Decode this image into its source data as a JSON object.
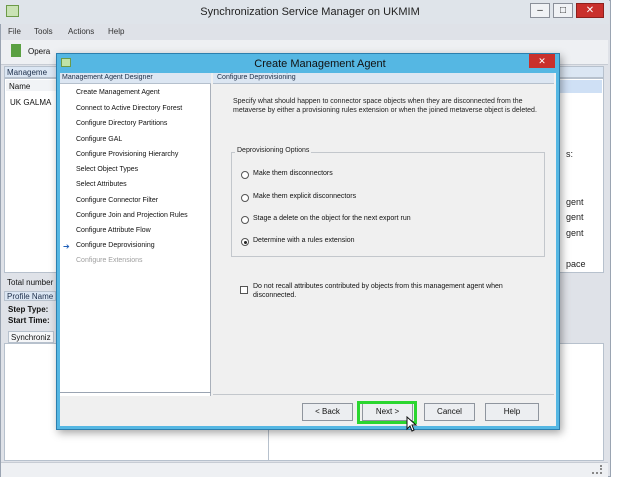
{
  "main_window": {
    "title": "Synchronization Service Manager on UKMIM",
    "controls": {
      "minimize": "–",
      "maximize": "□",
      "close": "✕"
    },
    "menu": [
      "File",
      "Tools",
      "Actions",
      "Help"
    ],
    "toolbar": {
      "operations_label": "Opera"
    },
    "management_agents_header": "Manageme",
    "columns": {
      "name": "Name"
    },
    "rows": [
      "UK GALMA"
    ],
    "right_fragments": [
      "gent",
      "gent",
      "gent",
      "pace",
      "s:"
    ],
    "total_label": "Total number",
    "profile_header": "Profile Name",
    "step_type_label": "Step Type:",
    "start_time_label": "Start Time:",
    "sync_tab_label": "Synchroniz"
  },
  "dialog": {
    "title": "Create Management Agent",
    "close": "✕",
    "nav": {
      "header": "Management Agent Designer",
      "items": [
        {
          "label": "Create Management Agent",
          "state": "done"
        },
        {
          "label": "Connect to Active Directory Forest",
          "state": "done"
        },
        {
          "label": "Configure Directory Partitions",
          "state": "done"
        },
        {
          "label": "Configure GAL",
          "state": "done"
        },
        {
          "label": "Configure Provisioning Hierarchy",
          "state": "done"
        },
        {
          "label": "Select Object Types",
          "state": "done"
        },
        {
          "label": "Select Attributes",
          "state": "done"
        },
        {
          "label": "Configure Connector Filter",
          "state": "done"
        },
        {
          "label": "Configure Join and Projection Rules",
          "state": "done"
        },
        {
          "label": "Configure Attribute Flow",
          "state": "done"
        },
        {
          "label": "Configure Deprovisioning",
          "state": "current"
        },
        {
          "label": "Configure Extensions",
          "state": "disabled"
        }
      ],
      "current_marker": "➔"
    },
    "content": {
      "header": "Configure Deprovisioning",
      "description": "Specify what should happen to connector space objects when they are disconnected from the metaverse by either a provisioning rules extension or when the joined metaverse object is deleted.",
      "group_title": "Deprovisioning Options",
      "options": [
        {
          "label": "Make them disconnectors",
          "selected": false
        },
        {
          "label": "Make them explicit disconnectors",
          "selected": false
        },
        {
          "label": "Stage a delete on the object for the next export run",
          "selected": false
        },
        {
          "label": "Determine with a rules extension",
          "selected": true
        }
      ],
      "checkbox": {
        "label": "Do not recall attributes contributed by objects from this management agent when disconnected.",
        "checked": false
      }
    },
    "buttons": {
      "back": "< Back",
      "next": "Next >",
      "cancel": "Cancel",
      "help": "Help"
    },
    "highlight_color": "#2bd630"
  }
}
